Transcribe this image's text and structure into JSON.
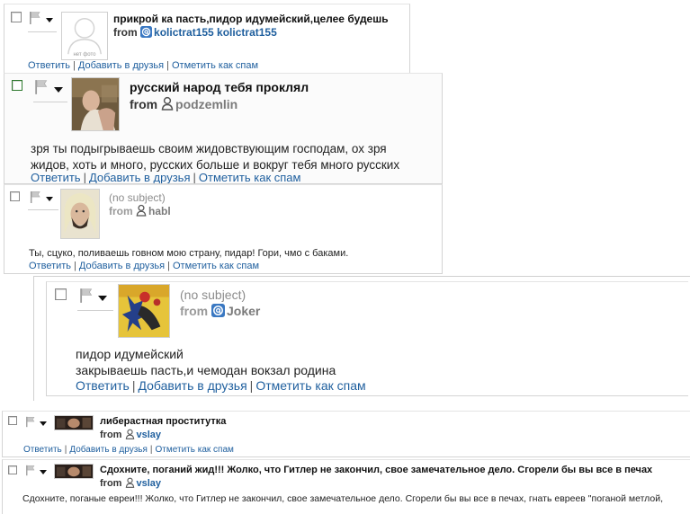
{
  "actions": {
    "reply": "Ответить",
    "add_friend": "Добавить в друзья",
    "mark_spam": "Отметить как спам",
    "separator": "|"
  },
  "messages": [
    {
      "subject": "прикрой ка пасть,пидор идумейский,целее будешь",
      "from_label": "from",
      "sender_icon": "at-sign-icon",
      "sender": "kolictrat155 kolictrat155",
      "avatar_caption": "нет фото"
    },
    {
      "subject": "русский народ тебя проклял",
      "from_label": "from",
      "sender_icon": "user-icon",
      "sender": "podzemlin",
      "body_lines": [
        "зря ты подыгрываешь своим жидовствующим господам, ох зря",
        "жидов, хоть и много, русских больше и вокруг тебя много русских"
      ]
    },
    {
      "subject": "(no subject)",
      "from_label": "from",
      "sender_icon": "user-icon",
      "sender": "habl",
      "body_lines": [
        "Ты, сцуко, поливаешь говном мою страну, пидар! Гори, чмо с баками."
      ]
    },
    {
      "subject": "(no subject)",
      "from_label": "from",
      "sender_icon": "at-sign-icon",
      "sender": "Joker",
      "body_lines": [
        "пидор идумейский",
        "закрываешь пасть,и чемодан вокзал родина"
      ]
    },
    {
      "subject": "либерастная проститутка",
      "from_label": "from",
      "sender_icon": "user-icon",
      "sender": "vslay"
    },
    {
      "subject": "Сдохните, поганий жид!!! Жолко, что Гитлер не закончил, свое замечательное дело. Сгорели бы вы все в печах",
      "from_label": "from",
      "sender_icon": "user-icon",
      "sender": "vslay",
      "body_lines": [
        "Сдохните, поганые евреи!!! Жолко, что Гитлер не закончил, свое замечательное дело. Сгорели бы вы все в печах, гнать евреев \"поганой метлой,"
      ]
    }
  ],
  "colors": {
    "link": "#1f5f9e",
    "subject_none": "#8c8c8c",
    "border": "#d4d4d4"
  }
}
